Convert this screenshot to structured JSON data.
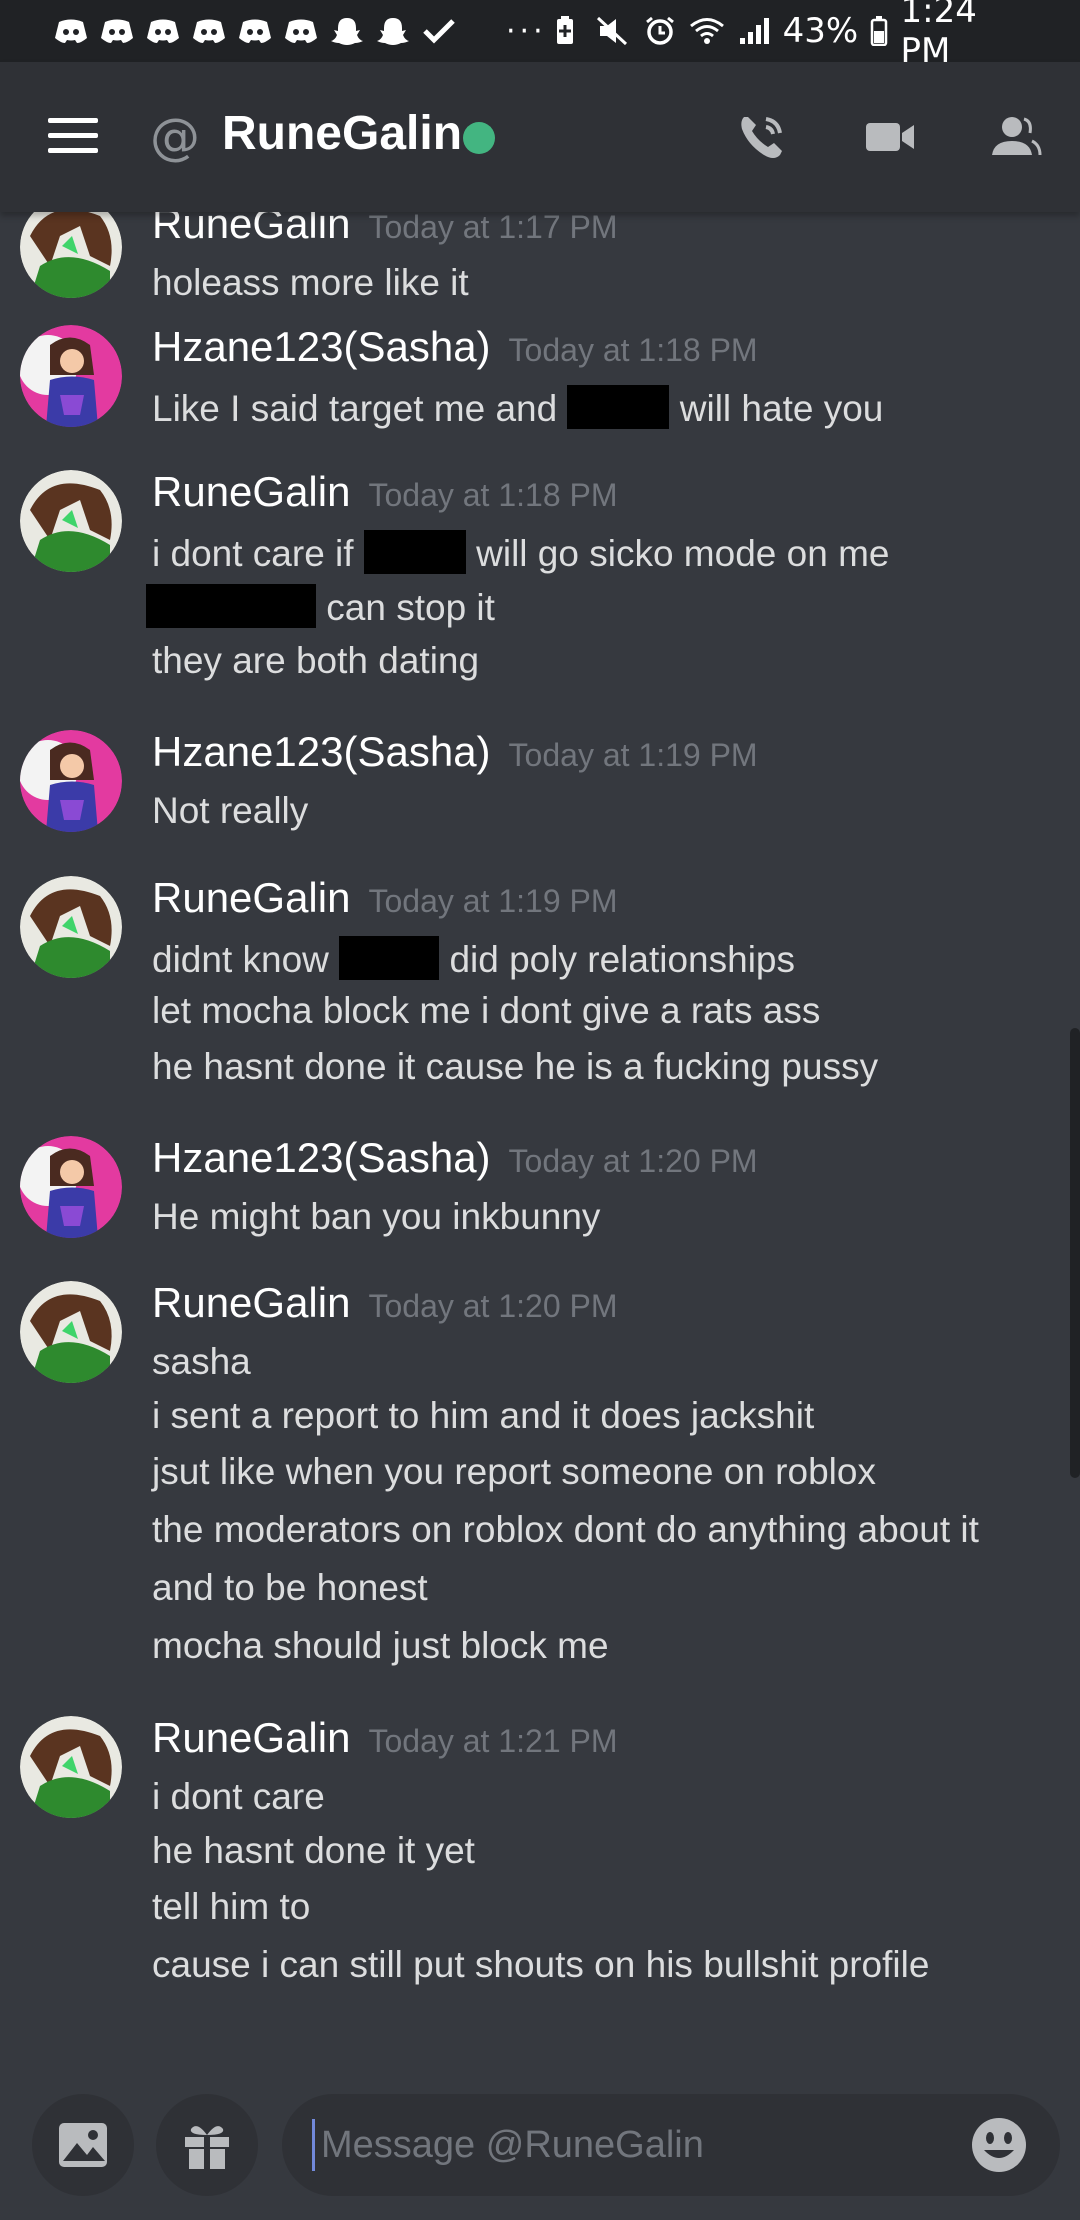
{
  "statusbar": {
    "notif_icons": [
      "discord-icon",
      "discord-icon",
      "discord-icon",
      "discord-icon",
      "discord-icon",
      "discord-icon",
      "snapchat-icon",
      "snapchat-icon",
      "check-icon"
    ],
    "more": "···",
    "battery_percent": "43%",
    "time": "1:24 PM"
  },
  "header": {
    "at_symbol": "@",
    "channel_name": "RuneGalin",
    "status": "online",
    "status_color": "#43b581"
  },
  "messages": [
    {
      "author": "RuneGalin",
      "timestamp": "Today at 1:17 PM",
      "lines": [
        "holeass more like it"
      ]
    },
    {
      "author": "Hzane123(Sasha)",
      "timestamp": "Today at 1:18 PM",
      "lines": [
        {
          "before": "Like I said target me and",
          "after": "will hate you"
        }
      ]
    },
    {
      "author": "RuneGalin",
      "timestamp": "Today at 1:18 PM",
      "lines": [
        {
          "before": "i dont care if",
          "after": "will go sicko mode on me"
        },
        {
          "before": "",
          "after": "can stop it"
        },
        "they are both dating"
      ]
    },
    {
      "author": "Hzane123(Sasha)",
      "timestamp": "Today at 1:19 PM",
      "lines": [
        "Not really"
      ]
    },
    {
      "author": "RuneGalin",
      "timestamp": "Today at 1:19 PM",
      "lines": [
        {
          "before": "didnt know",
          "after": "did poly relationships"
        },
        "let mocha block me i dont give a rats ass",
        "he hasnt done it cause he is a fucking pussy"
      ]
    },
    {
      "author": "Hzane123(Sasha)",
      "timestamp": "Today at 1:20 PM",
      "lines": [
        "He might ban you inkbunny"
      ]
    },
    {
      "author": "RuneGalin",
      "timestamp": "Today at 1:20 PM",
      "lines": [
        "sasha",
        "i sent a report to him and it does jackshit",
        "jsut like when you report someone on roblox",
        "the moderators on roblox dont do anything about it",
        "and to be honest",
        "mocha should just block me"
      ]
    },
    {
      "author": "RuneGalin",
      "timestamp": "Today at 1:21 PM",
      "lines": [
        "i dont care",
        "he hasnt done it yet",
        "tell him to",
        "cause i can still put shouts on his bullshit profile"
      ]
    }
  ],
  "composer": {
    "placeholder": "Message @RuneGalin"
  },
  "colors": {
    "background": "#36393f",
    "header_bg": "#2f3136",
    "statusbar_bg": "#202225",
    "timestamp": "#72767d",
    "text": "#dcddde"
  }
}
